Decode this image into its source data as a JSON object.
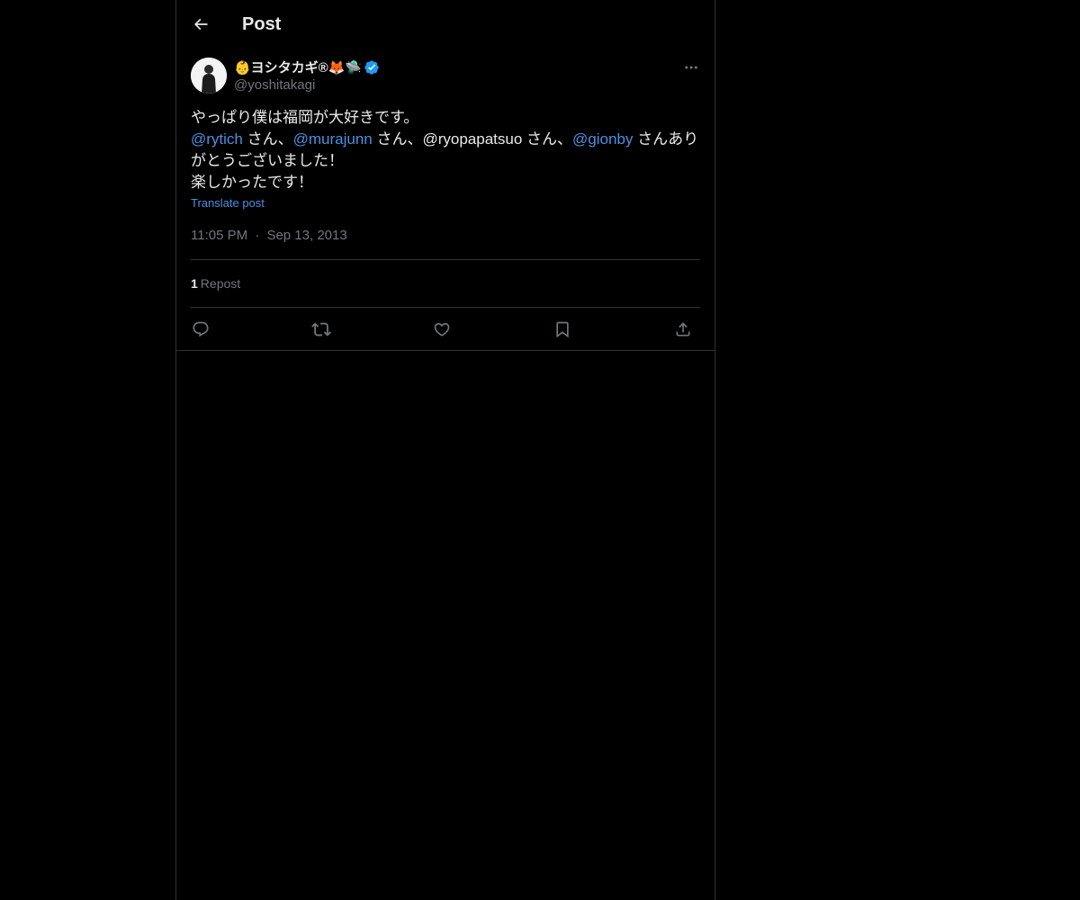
{
  "header": {
    "title": "Post",
    "back_icon": "arrow-left-icon"
  },
  "author": {
    "display_name": "👶ヨシタカギ®🦊🛸",
    "handle": "@yoshitakagi",
    "verified": true,
    "verified_color": "#1d9bf0"
  },
  "post": {
    "line1": "やっぱり僕は福岡が大好きです。",
    "mention1": "@rytich",
    "sep1": " さん、",
    "mention2": "@murajunn",
    "sep2": " さん、@ryopapatsuo さん、",
    "mention3": "@gionby",
    "line2_end": " さんありがとうございました！",
    "line3": "楽しかったです！",
    "translate_label": "Translate post"
  },
  "meta": {
    "time": "11:05 PM",
    "separator": "·",
    "date": "Sep 13, 2013"
  },
  "stats": {
    "repost_count": "1",
    "repost_label": "Repost"
  },
  "actions": [
    "reply-icon",
    "repost-icon",
    "like-icon",
    "bookmark-icon",
    "share-icon"
  ],
  "colors": {
    "background": "#000000",
    "text": "#e7e9ea",
    "secondary": "#71767b",
    "accent": "#4c8fe0",
    "border": "#2f3336"
  }
}
